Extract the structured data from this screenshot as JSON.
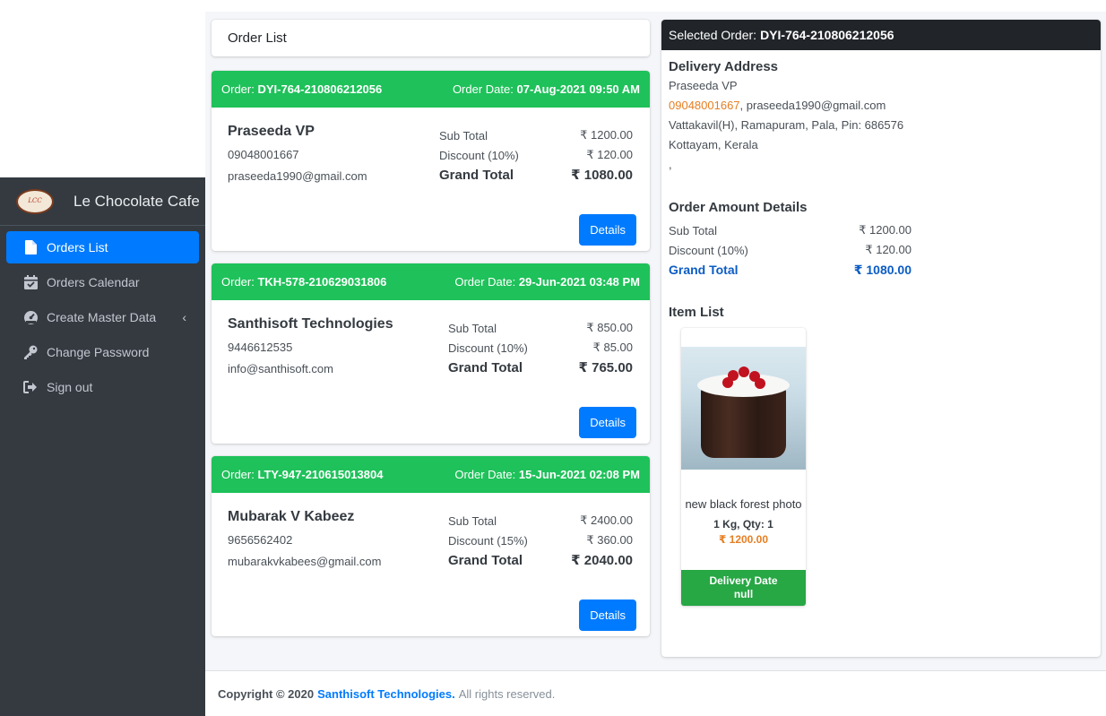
{
  "sidebar": {
    "brand": {
      "logo_text": "Le Chocolate Cafe",
      "name": "Le Chocolate Cafe"
    },
    "items": [
      {
        "label": "Orders List",
        "icon": "file-icon",
        "active": true
      },
      {
        "label": "Orders Calendar",
        "icon": "calendar-check-icon",
        "active": false
      },
      {
        "label": "Create Master Data",
        "icon": "dashboard-icon",
        "active": false,
        "has_arrow": true
      },
      {
        "label": "Change Password",
        "icon": "key-icon",
        "active": false
      },
      {
        "label": "Sign out",
        "icon": "sign-out-icon",
        "active": false
      }
    ]
  },
  "order_list": {
    "title": "Order List",
    "orders": [
      {
        "order_label": "Order:",
        "order_id": "DYI-764-210806212056",
        "date_label": "Order Date:",
        "date": "07-Aug-2021 09:50 AM",
        "name": "Praseeda VP",
        "phone": "09048001667",
        "email": "praseeda1990@gmail.com",
        "subtotal_label": "Sub Total",
        "subtotal": "₹ 1200.00",
        "discount_label": "Discount (10%)",
        "discount": "₹ 120.00",
        "grand_label": "Grand Total",
        "grand": "₹ 1080.00",
        "button": "Details"
      },
      {
        "order_label": "Order:",
        "order_id": "TKH-578-210629031806",
        "date_label": "Order Date:",
        "date": "29-Jun-2021 03:48 PM",
        "name": "Santhisoft Technologies",
        "phone": "9446612535",
        "email": "info@santhisoft.com",
        "subtotal_label": "Sub Total",
        "subtotal": "₹ 850.00",
        "discount_label": "Discount (10%)",
        "discount": "₹ 85.00",
        "grand_label": "Grand Total",
        "grand": "₹ 765.00",
        "button": "Details"
      },
      {
        "order_label": "Order:",
        "order_id": "LTY-947-210615013804",
        "date_label": "Order Date:",
        "date": "15-Jun-2021 02:08 PM",
        "name": "Mubarak V Kabeez",
        "phone": "9656562402",
        "email": "mubarakvkabees@gmail.com",
        "subtotal_label": "Sub Total",
        "subtotal": "₹ 2400.00",
        "discount_label": "Discount (15%)",
        "discount": "₹ 360.00",
        "grand_label": "Grand Total",
        "grand": "₹ 2040.00",
        "button": "Details"
      }
    ]
  },
  "selected": {
    "head_label": "Selected Order:",
    "order_id": "DYI-764-210806212056",
    "address_title": "Delivery Address",
    "name": "Praseeda VP",
    "phone": "09048001667",
    "email_sep": ", praseeda1990@gmail.com",
    "address1": "Vattakavil(H), Ramapuram, Pala, Pin: 686576",
    "address2": "Kottayam, Kerala",
    "address3": ",",
    "amount_title": "Order Amount Details",
    "subtotal_label": "Sub Total",
    "subtotal": "₹ 1200.00",
    "discount_label": "Discount (10%)",
    "discount": "₹ 120.00",
    "grand_label": "Grand Total",
    "grand": "₹ 1080.00",
    "items_title": "Item List",
    "item": {
      "name": "new black forest photo",
      "qty": "1 Kg, Qty: 1",
      "price": "₹ 1200.00",
      "date_label": "Delivery Date",
      "date_value": "null"
    }
  },
  "footer": {
    "copyright": "Copyright © 2020",
    "company": "Santhisoft Technologies.",
    "rights": "All rights reserved."
  },
  "colors": {
    "accent": "#007bff",
    "order_header": "#1fc15a",
    "sidebar": "#343a40",
    "delivery": "#28a745",
    "price": "#e67e22"
  }
}
